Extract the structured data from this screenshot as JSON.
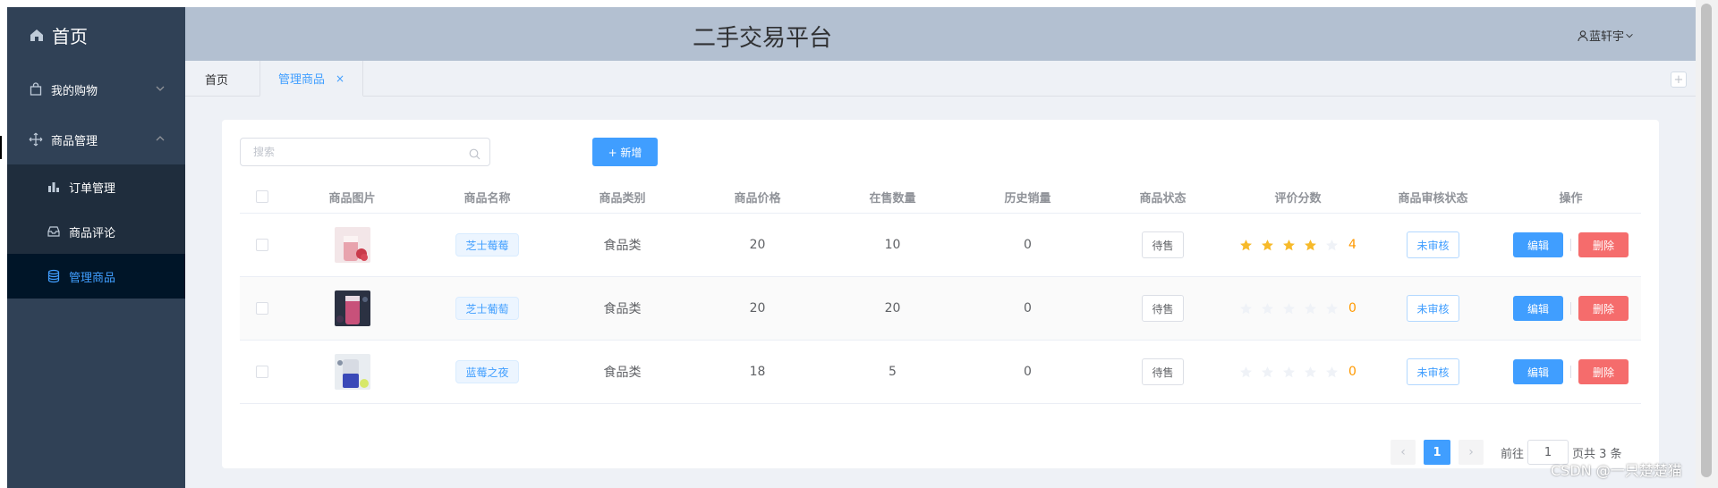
{
  "sidebar": {
    "home_label": "首页",
    "menu": [
      {
        "label": "我的购物",
        "icon": "shopping-bag-icon"
      },
      {
        "label": "商品管理",
        "icon": "move-icon"
      }
    ],
    "submenu": [
      {
        "label": "订单管理",
        "icon": "bar-chart-icon"
      },
      {
        "label": "商品评论",
        "icon": "message-box-icon"
      },
      {
        "label": "管理商品",
        "icon": "coin-stack-icon"
      }
    ]
  },
  "header": {
    "title": "二手交易平台",
    "user_name": "蓝轩宇"
  },
  "tabs": [
    {
      "label": "首页"
    },
    {
      "label": "管理商品",
      "close": "×"
    }
  ],
  "tabs_add": "+",
  "toolbar": {
    "search_placeholder": "搜索",
    "add_label": "+ 新增"
  },
  "table": {
    "columns": [
      "商品图片",
      "商品名称",
      "商品类别",
      "商品价格",
      "在售数量",
      "历史销量",
      "商品状态",
      "评价分数",
      "商品审核状态",
      "操作"
    ],
    "rows": [
      {
        "name": "芝士莓莓",
        "category": "食品类",
        "price": "20",
        "stock": "10",
        "sold": "0",
        "status": "待售",
        "rating": 4,
        "score": "4",
        "audit": "未审核",
        "edit": "编辑",
        "delete": "删除"
      },
      {
        "name": "芝士葡萄",
        "category": "食品类",
        "price": "20",
        "stock": "20",
        "sold": "0",
        "status": "待售",
        "rating": 0,
        "score": "0",
        "audit": "未审核",
        "edit": "编辑",
        "delete": "删除"
      },
      {
        "name": "蓝莓之夜",
        "category": "食品类",
        "price": "18",
        "stock": "5",
        "sold": "0",
        "status": "待售",
        "rating": 0,
        "score": "0",
        "audit": "未审核",
        "edit": "编辑",
        "delete": "删除"
      }
    ]
  },
  "pagination": {
    "prev": "‹",
    "next": "›",
    "current_page": "1",
    "goto_prefix": "前往",
    "goto_value": "1",
    "goto_suffix": "页共 3 条"
  },
  "watermark": "CSDN @一只楚楚猫",
  "colors": {
    "primary": "#409eff",
    "danger": "#f56c6c",
    "star_on": "#f7ba2a",
    "star_off": "#eff2f7",
    "sidebar_bg": "#304156"
  }
}
